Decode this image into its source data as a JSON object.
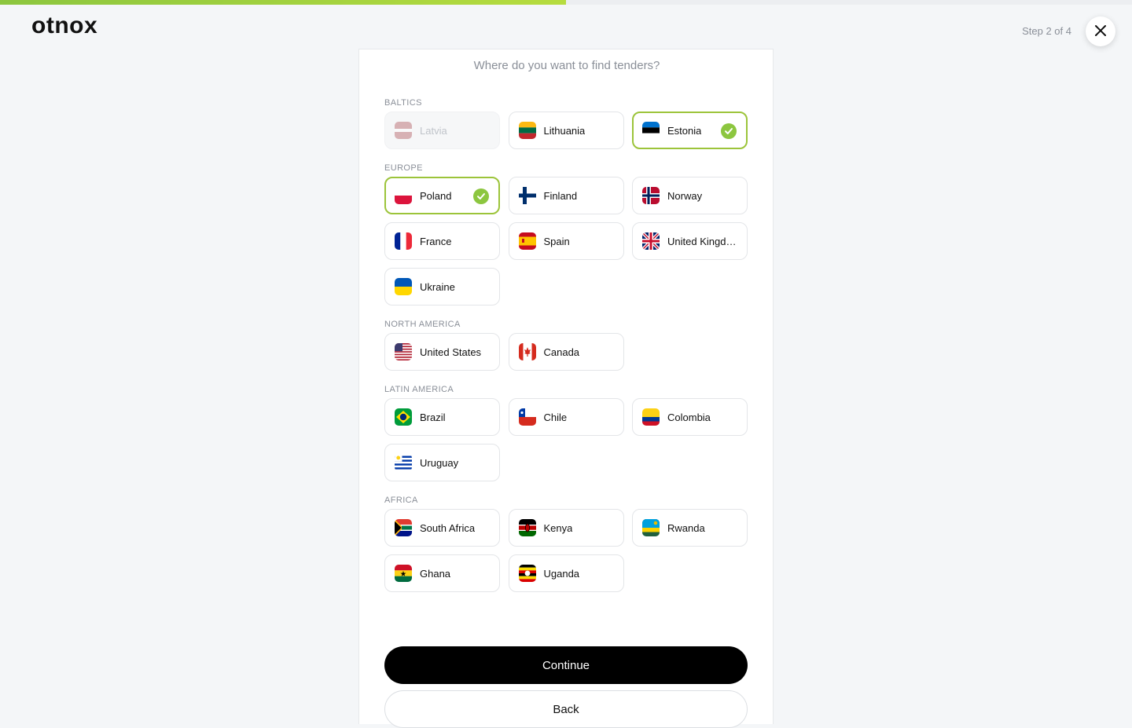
{
  "header": {
    "logo": "otnox",
    "step": "Step 2 of 4",
    "progress": 0.5
  },
  "card": {
    "subtitle": "Where do you want to find tenders?",
    "continue_label": "Continue",
    "back_label": "Back"
  },
  "colors": {
    "accent": "#8cc63f",
    "primary": "#000000"
  },
  "sections": [
    {
      "label": "BALTICS",
      "countries": [
        {
          "name": "Latvia",
          "flag": "lv",
          "state": "disabled"
        },
        {
          "name": "Lithuania",
          "flag": "lt",
          "state": "default"
        },
        {
          "name": "Estonia",
          "flag": "ee",
          "state": "selected"
        }
      ]
    },
    {
      "label": "EUROPE",
      "countries": [
        {
          "name": "Poland",
          "flag": "pl",
          "state": "selected"
        },
        {
          "name": "Finland",
          "flag": "fi",
          "state": "default"
        },
        {
          "name": "Norway",
          "flag": "no",
          "state": "default"
        },
        {
          "name": "France",
          "flag": "fr",
          "state": "default"
        },
        {
          "name": "Spain",
          "flag": "es",
          "state": "default"
        },
        {
          "name": "United Kingdom",
          "flag": "gb",
          "state": "default"
        },
        {
          "name": "Ukraine",
          "flag": "ua",
          "state": "default"
        }
      ]
    },
    {
      "label": "NORTH AMERICA",
      "countries": [
        {
          "name": "United States",
          "flag": "us",
          "state": "default"
        },
        {
          "name": "Canada",
          "flag": "ca",
          "state": "default"
        }
      ]
    },
    {
      "label": "LATIN AMERICA",
      "countries": [
        {
          "name": "Brazil",
          "flag": "br",
          "state": "default"
        },
        {
          "name": "Chile",
          "flag": "cl",
          "state": "default"
        },
        {
          "name": "Colombia",
          "flag": "co",
          "state": "default"
        },
        {
          "name": "Uruguay",
          "flag": "uy",
          "state": "default"
        }
      ]
    },
    {
      "label": "AFRICA",
      "countries": [
        {
          "name": "South Africa",
          "flag": "za",
          "state": "default"
        },
        {
          "name": "Kenya",
          "flag": "ke",
          "state": "default"
        },
        {
          "name": "Rwanda",
          "flag": "rw",
          "state": "default"
        },
        {
          "name": "Ghana",
          "flag": "gh",
          "state": "default"
        },
        {
          "name": "Uganda",
          "flag": "ug",
          "state": "default"
        }
      ]
    }
  ]
}
